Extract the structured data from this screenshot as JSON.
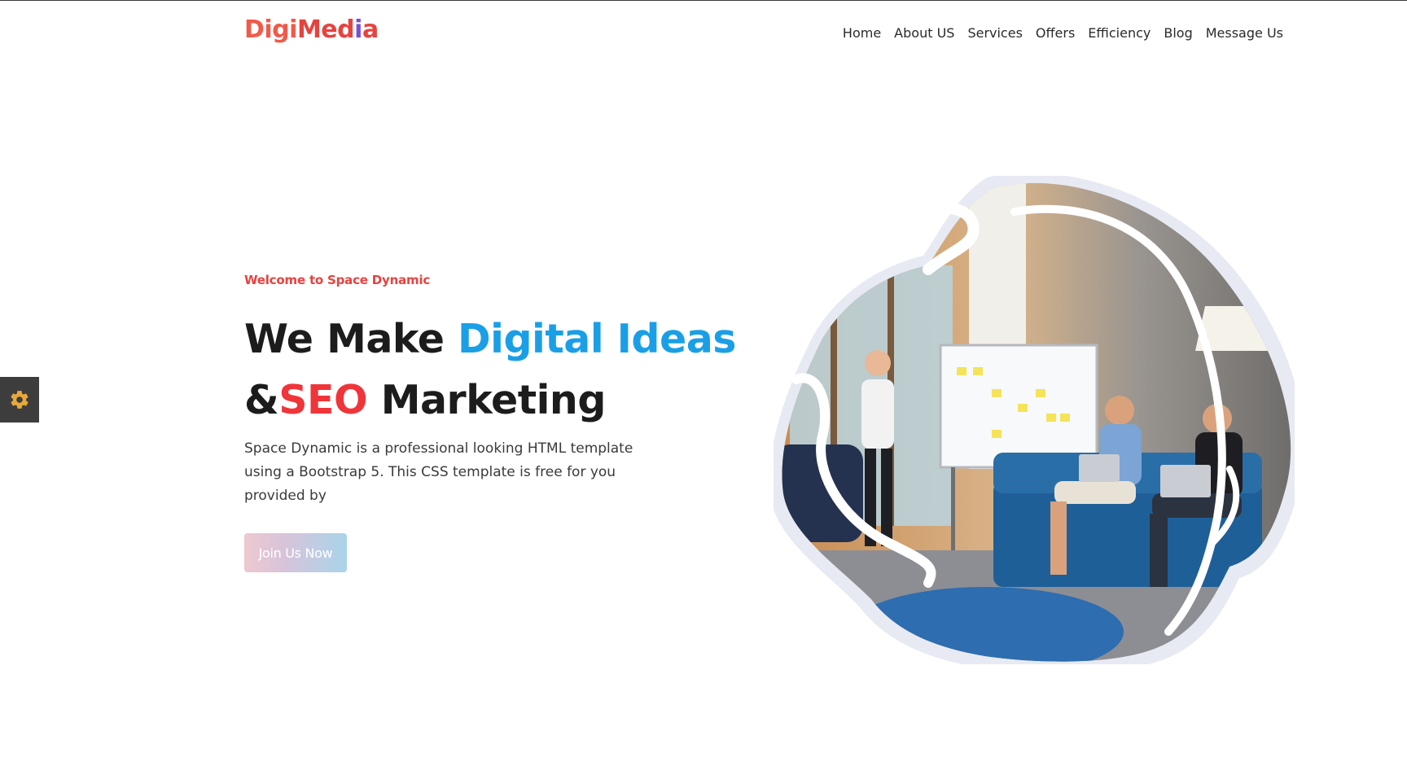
{
  "header": {
    "logo": {
      "part1": "Digi",
      "part2": "Med",
      "part3": "i",
      "part4": "a"
    },
    "nav": [
      {
        "label": "Home"
      },
      {
        "label": "About US"
      },
      {
        "label": "Services"
      },
      {
        "label": "Offers"
      },
      {
        "label": "Efficiency"
      },
      {
        "label": "Blog"
      },
      {
        "label": "Message Us"
      }
    ]
  },
  "hero": {
    "welcome": "Welcome to Space Dynamic",
    "headline": {
      "line1_a": "We Make ",
      "line1_b": "Digital Ideas",
      "line2_a": "&",
      "line2_b": "SEO",
      "line2_c": " Marketing"
    },
    "description": "Space Dynamic is a professional looking HTML template using a Bootstrap 5. This CSS template is free for you provided by",
    "cta_label": "Join Us Now"
  },
  "settings": {
    "icon": "gear-icon"
  },
  "colors": {
    "accent_red": "#e6433f",
    "accent_blue": "#1a9fe6",
    "settings_bg": "#3d3d3d",
    "gear": "#e8a93a"
  }
}
